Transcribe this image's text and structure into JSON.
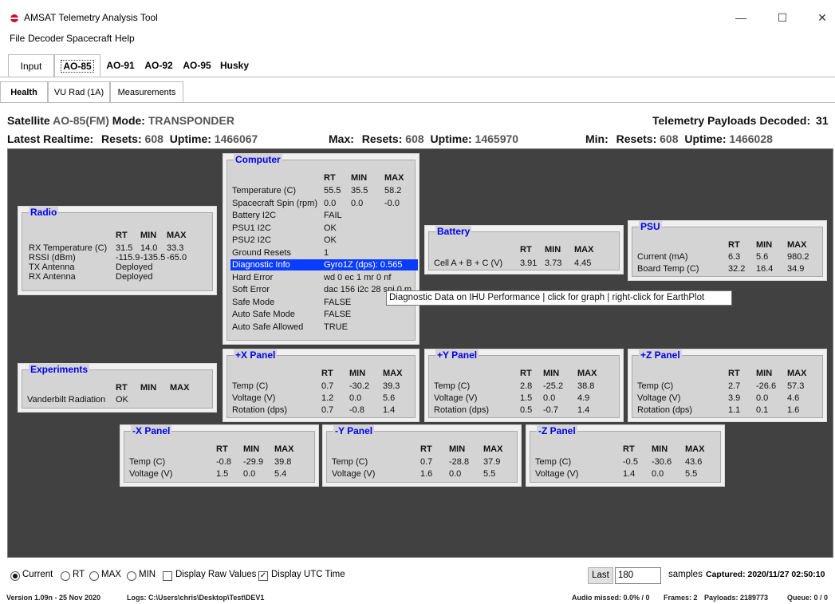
{
  "window": {
    "title": "AMSAT Telemetry Analysis Tool",
    "minimize": "—",
    "maximize": "☐",
    "close": "✕",
    "icon": "satellite-icon"
  },
  "menu": [
    "File",
    "Decoder",
    "Spacecraft",
    "Help"
  ],
  "top_tabs": [
    "Input",
    "AO-85",
    "AO-91",
    "AO-92",
    "AO-95",
    "Husky"
  ],
  "sub_tabs": [
    "Health",
    "VU Rad (1A)",
    "Measurements"
  ],
  "header": {
    "satellite_label": "Satellite",
    "satellite_value": "AO-85(FM)",
    "mode_label": "Mode:",
    "mode_value": "TRANSPONDER",
    "payloads_label": "Telemetry Payloads Decoded:",
    "payloads_value": "31",
    "latest_label": "Latest Realtime:",
    "latest_resets_label": "Resets:",
    "latest_resets": "608",
    "latest_uptime_label": "Uptime:",
    "latest_uptime": "1466067",
    "max_label": "Max:",
    "max_resets_label": "Resets:",
    "max_resets": "608",
    "max_uptime_label": "Uptime:",
    "max_uptime": "1465970",
    "min_label": "Min:",
    "min_resets_label": "Resets:",
    "min_resets": "608",
    "min_uptime_label": "Uptime:",
    "min_uptime": "1466028"
  },
  "cols": {
    "rt": "RT",
    "min": "MIN",
    "max": "MAX"
  },
  "panels": {
    "radio": {
      "title": "Radio",
      "rows": [
        [
          "RX Temperature (C)",
          "31.5",
          "14.0",
          "33.3"
        ],
        [
          "RSSI (dBm)",
          "-115.9",
          "-135.5",
          "-65.0"
        ],
        [
          "TX Antenna",
          "Deployed",
          "",
          ""
        ],
        [
          "RX Antenna",
          "Deployed",
          "",
          ""
        ]
      ]
    },
    "computer": {
      "title": "Computer",
      "rows": [
        [
          "Temperature (C)",
          "55.5",
          "35.5",
          "58.2"
        ],
        [
          "Spacecraft Spin (rpm)",
          "0.0",
          "0.0",
          "-0.0"
        ],
        [
          "Battery I2C",
          "FAIL",
          "",
          ""
        ],
        [
          "PSU1 I2C",
          "OK",
          "",
          ""
        ],
        [
          "PSU2 I2C",
          "OK",
          "",
          ""
        ],
        [
          "Ground Resets",
          "1",
          "",
          ""
        ],
        [
          "Diagnostic Info",
          "Gyro1Z (dps): 0.565",
          "",
          ""
        ],
        [
          "Hard Error",
          "wd 0 ec 1 mr 0 nf",
          "",
          ""
        ],
        [
          "Soft Error",
          "dac 156 i2c 28 spi 0 m...",
          "",
          ""
        ],
        [
          "Safe Mode",
          "FALSE",
          "",
          ""
        ],
        [
          "Auto Safe Mode",
          "FALSE",
          "",
          ""
        ],
        [
          "Auto Safe Allowed",
          "TRUE",
          "",
          ""
        ]
      ]
    },
    "battery": {
      "title": "Battery",
      "rows": [
        [
          "Cell A + B + C (V)",
          "3.91",
          "3.73",
          "4.45"
        ]
      ]
    },
    "psu": {
      "title": "PSU",
      "rows": [
        [
          "Current (mA)",
          "6.3",
          "5.6",
          "980.2"
        ],
        [
          "Board Temp (C)",
          "32.2",
          "16.4",
          "34.9"
        ]
      ]
    },
    "experiments": {
      "title": "Experiments",
      "rows": [
        [
          "Vanderbilt Radiation",
          "OK",
          "",
          ""
        ]
      ]
    },
    "xplus": {
      "title": "+X Panel",
      "rows": [
        [
          "Temp (C)",
          "0.7",
          "-30.2",
          "39.3"
        ],
        [
          "Voltage (V)",
          "1.2",
          "0.0",
          "5.6"
        ],
        [
          "Rotation (dps)",
          "0.7",
          "-0.8",
          "1.4"
        ]
      ]
    },
    "yplus": {
      "title": "+Y Panel",
      "rows": [
        [
          "Temp (C)",
          "2.8",
          "-25.2",
          "38.8"
        ],
        [
          "Voltage (V)",
          "1.5",
          "0.0",
          "4.9"
        ],
        [
          "Rotation (dps)",
          "0.5",
          "-0.7",
          "1.4"
        ]
      ]
    },
    "zplus": {
      "title": "+Z Panel",
      "rows": [
        [
          "Temp (C)",
          "2.7",
          "-26.6",
          "57.3"
        ],
        [
          "Voltage (V)",
          "3.9",
          "0.0",
          "4.6"
        ],
        [
          "Rotation (dps)",
          "1.1",
          "0.1",
          "1.6"
        ]
      ]
    },
    "xminus": {
      "title": "-X Panel",
      "rows": [
        [
          "Temp (C)",
          "-0.8",
          "-29.9",
          "39.8"
        ],
        [
          "Voltage (V)",
          "1.5",
          "0.0",
          "5.4"
        ]
      ]
    },
    "yminus": {
      "title": "-Y Panel",
      "rows": [
        [
          "Temp (C)",
          "0.7",
          "-28.8",
          "37.9"
        ],
        [
          "Voltage (V)",
          "1.6",
          "0.0",
          "5.5"
        ]
      ]
    },
    "zminus": {
      "title": "-Z Panel",
      "rows": [
        [
          "Temp (C)",
          "-0.5",
          "-30.6",
          "43.6"
        ],
        [
          "Voltage (V)",
          "1.4",
          "0.0",
          "5.5"
        ]
      ]
    }
  },
  "tooltip": "Diagnostic Data on IHU Performance | click for graph | right-click for EarthPlot",
  "bottom": {
    "radio_current": "Current",
    "radio_rt": "RT",
    "radio_max": "MAX",
    "radio_min": "MIN",
    "display_raw": "Display Raw Values",
    "display_utc": "Display UTC Time",
    "last_button": "Last",
    "samples_value": "180",
    "samples_label": "samples",
    "captured_label": "Captured: 2020/11/27 02:50:10"
  },
  "status": {
    "version": "Version 1.09n - 25 Nov 2020",
    "logs": "Logs: C:\\Users\\chris\\Desktop\\Test\\DEV1",
    "audio": "Audio missed: 0.0% / 0",
    "frames": "Frames: 2",
    "payloads": "Payloads: 2189773",
    "queue": "Queue: 0 / 0"
  }
}
